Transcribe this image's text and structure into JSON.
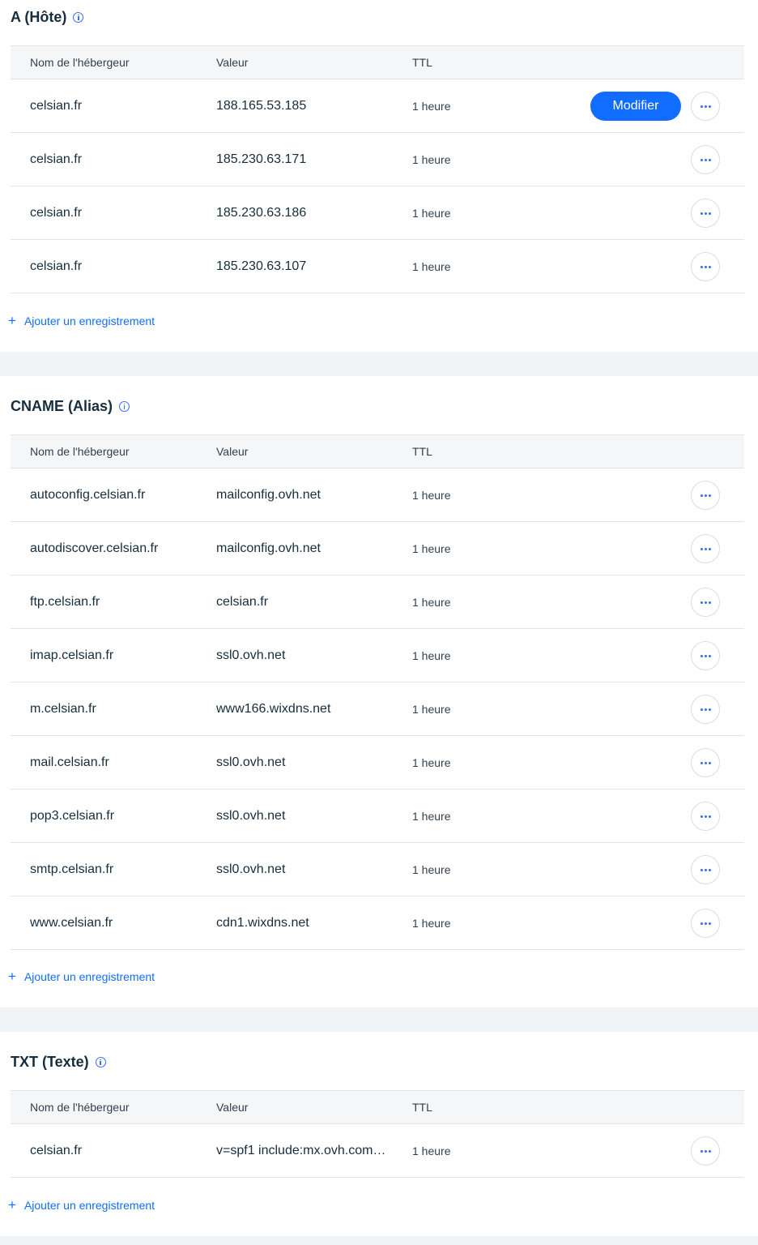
{
  "add_record_label": "Ajouter un enregistrement",
  "columns": {
    "host": "Nom de l'hébergeur",
    "value": "Valeur",
    "ttl": "TTL"
  },
  "edit_label": "Modifier",
  "sections": [
    {
      "title": "A (Hôte)",
      "rows": [
        {
          "host": "celsian.fr",
          "value": "188.165.53.185",
          "ttl": "1 heure"
        },
        {
          "host": "celsian.fr",
          "value": "185.230.63.171",
          "ttl": "1 heure"
        },
        {
          "host": "celsian.fr",
          "value": "185.230.63.186",
          "ttl": "1 heure"
        },
        {
          "host": "celsian.fr",
          "value": "185.230.63.107",
          "ttl": "1 heure"
        }
      ]
    },
    {
      "title": "CNAME (Alias)",
      "rows": [
        {
          "host": "autoconfig.celsian.fr",
          "value": "mailconfig.ovh.net",
          "ttl": "1 heure"
        },
        {
          "host": "autodiscover.celsian.fr",
          "value": "mailconfig.ovh.net",
          "ttl": "1 heure"
        },
        {
          "host": "ftp.celsian.fr",
          "value": "celsian.fr",
          "ttl": "1 heure"
        },
        {
          "host": "imap.celsian.fr",
          "value": "ssl0.ovh.net",
          "ttl": "1 heure"
        },
        {
          "host": "m.celsian.fr",
          "value": "www166.wixdns.net",
          "ttl": "1 heure"
        },
        {
          "host": "mail.celsian.fr",
          "value": "ssl0.ovh.net",
          "ttl": "1 heure"
        },
        {
          "host": "pop3.celsian.fr",
          "value": "ssl0.ovh.net",
          "ttl": "1 heure"
        },
        {
          "host": "smtp.celsian.fr",
          "value": "ssl0.ovh.net",
          "ttl": "1 heure"
        },
        {
          "host": "www.celsian.fr",
          "value": "cdn1.wixdns.net",
          "ttl": "1 heure"
        }
      ]
    },
    {
      "title": "TXT (Texte)",
      "rows": [
        {
          "host": "celsian.fr",
          "value": "v=spf1 include:mx.ovh.com…",
          "ttl": "1 heure"
        }
      ]
    }
  ],
  "icons": {
    "info": "info-icon",
    "more": "more-options-icon",
    "add": "plus-icon"
  },
  "colors": {
    "accent": "#116dff",
    "section_gap": "#f0f4f7",
    "header_bg": "#f4f6f8"
  }
}
